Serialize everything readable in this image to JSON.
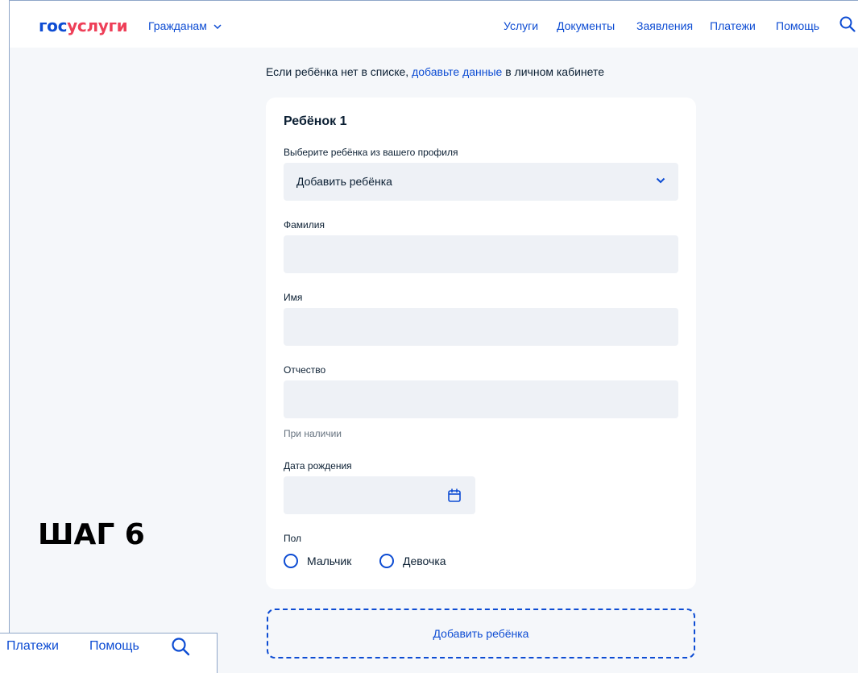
{
  "header": {
    "logo_part1": "гос",
    "logo_part2": "услуги",
    "citizens_menu": "Гражданам",
    "nav": [
      "Услуги",
      "Документы",
      "Заявления",
      "Платежи",
      "Помощь"
    ]
  },
  "hint": {
    "before": "Если ребёнка нет в списке, ",
    "link": "добавьте данные",
    "after": " в личном кабинете"
  },
  "card": {
    "title": "Ребёнок 1",
    "select_label": "Выберите ребёнка из вашего профиля",
    "select_value": "Добавить ребёнка",
    "last_name_label": "Фамилия",
    "last_name_value": "",
    "first_name_label": "Имя",
    "first_name_value": "",
    "patronymic_label": "Отчество",
    "patronymic_value": "",
    "patronymic_hint": "При наличии",
    "birthdate_label": "Дата рождения",
    "birthdate_value": "",
    "gender_label": "Пол",
    "gender_options": [
      "Мальчик",
      "Девочка"
    ]
  },
  "add_child_button": "Добавить ребёнка",
  "step_label": "ШАГ 6",
  "inset_nav": [
    "Платежи",
    "Помощь"
  ],
  "colors": {
    "brand_blue": "#0d4cd3",
    "brand_red": "#ee3f58",
    "page_background": "#f5f7fa",
    "field_background": "#eef1f6"
  }
}
